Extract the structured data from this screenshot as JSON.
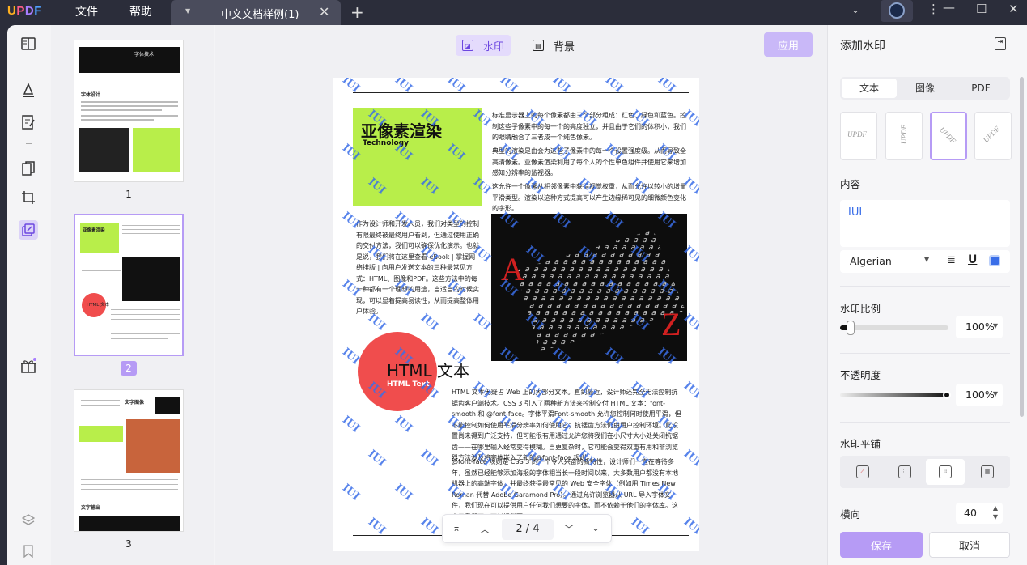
{
  "app": {
    "logo": "UPDF",
    "menu": [
      "文件",
      "帮助"
    ],
    "tab_title": "中文文档样例(1)"
  },
  "thumbnails": {
    "pages": [
      "1",
      "2",
      "3"
    ],
    "selected": "2",
    "page1_title": "字体技术",
    "page1_heading": "字体设计",
    "page2_title": "亚像素渲染",
    "page2_html": "HTML 文本",
    "page3_title": "文字图像",
    "page3_heading": "文字输出"
  },
  "toolbar": {
    "watermark_label": "水印",
    "background_label": "背景",
    "apply_label": "应用"
  },
  "document": {
    "green_title": "亚像素渲染",
    "green_subtitle": "Technology",
    "para_right_1": "标准显示器上的每个像素都由三个部分组成：红色、绿色和蓝色。控制这些子像素中的每一个的亮度独立，并且由于它们的体积小，我们的眼睛融合了三者成一个纯色像素。",
    "para_right_2": "典型的渲染是由会为这些子像素中的每一个设置强度级。从而导致全高清像素。亚像素渲染利用了每个人的个性单色组件并使用它来增加感知分辨率的监视器。",
    "para_right_3": "这允许一个像素从相邻像素中获得视觉权重，从而允许以较小的增量平滑类型。渲染以这种方式提高可以产生边缘稀可见的细微颜色变化的字形。",
    "para_left": "作为设计师和开发人员，我们对类型的控制有限最终被最终用户看到，但通过使用正确的交付方法，我们可以确保优化演示。也就是说，我们将在这里查看 eBook | 掌握网络排版 | 向用户发送文本的三种最常见方式：HTML、图像和PDF。这些方法中的每一种都有一个理想的用途，当适当的时候实现，可以显着提高易读性，从而提高整体用户体验。",
    "html_title": "HTML 文本",
    "html_subtitle": "HTML Text",
    "para_html_1": "HTML 文本无疑占 Web 上的大部分文本。直到最近，设计师还完全无法控制抗锯齿客户端技术。CSS 3 引入了两种新方法来控制交付 HTML 文本：font-smooth 和 @font-face。字体平滑Font-smooth 允许您控制何时使用平滑，但不能控制如何使用平滑分辨率如何使用它；抗锯齿方法仍由用户控制环境。此设置尚未得到广泛支持，但可能很有用通过允许您将我们在小尺寸大小处关闭抗锯齿——在哪里输入经常变得模糊。当更复杂时，它可能会变得双重有用和非浏览器方法涉及将字体嵌入了新的@font-face 规则。",
    "para_html_2": "@font-face 规则是 CSS 3 的一个令人兴奋的新特性，设计师们一直在等待多年，虽然已经能够添加海报的字体相当长一段时间以来，大多数用户都没有本地机器上的高端字体，并最终获得最常见的 Web 安全字体（例如用 Times New Roman 代替 Adobe Garamond Pro）。通过允许浏览器从 URL 导入字体文件，我们现在可以提供用户任何我们想要的字体，而不依赖于他们的字体库。这表示我们不仅可以提供更"
  },
  "watermark_text": "IUI",
  "pager": {
    "current": "2",
    "separator": "/",
    "total": "4"
  },
  "panel": {
    "title": "添加水印",
    "tabs": [
      "文本",
      "图像",
      "PDF"
    ],
    "active_tab": "文本",
    "style_sample": "UPDF",
    "content_label": "内容",
    "content_value": "IUI",
    "font_name": "Algerian",
    "underline_glyph": "U",
    "scale_label": "水印比例",
    "scale_value": "100%",
    "scale_level": 0.1,
    "opacity_label": "不透明度",
    "opacity_value": "100%",
    "opacity_level": 1.0,
    "tile_label": "水印平铺",
    "horizontal_label": "横向",
    "horizontal_value": "40",
    "save_label": "保存",
    "cancel_label": "取消"
  },
  "colors": {
    "accent": "#b69bf5",
    "accent_text": "#6c47e0",
    "watermark": "#3a6ee8",
    "green": "#b8ee4a",
    "red": "#f04d4d"
  }
}
